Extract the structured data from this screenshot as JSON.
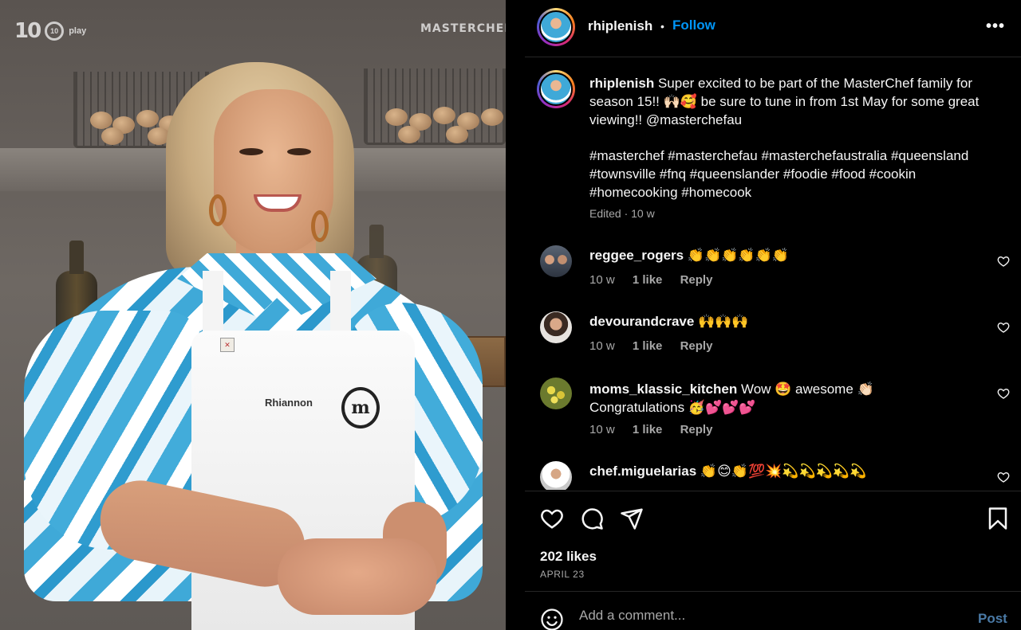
{
  "photo": {
    "network_logo": "10",
    "network_play": "play",
    "show_watermark": "MASTERCHEF",
    "apron_name": "Rhiannon",
    "apron_logo": "m"
  },
  "header": {
    "username": "rhiplenish",
    "separator": "•",
    "follow_label": "Follow",
    "more_icon": "more-options-icon",
    "more_glyph": "•••"
  },
  "caption": {
    "username": "rhiplenish",
    "text": "Super excited to be part of the MasterChef family for season 15!! 🙌🏻🥰 be sure to tune in from 1st May for some great viewing!! @masterchefau",
    "hashtags": "#masterchef #masterchefau #masterchefaustralia #queensland #townsville #fnq #queenslander #foodie #food #cookin #homecooking #homecook",
    "edited": "Edited · 10 w"
  },
  "comments": [
    {
      "username": "reggee_rogers",
      "text": "👏👏👏👏👏👏",
      "time": "10 w",
      "likes": "1 like",
      "reply": "Reply"
    },
    {
      "username": "devourandcrave",
      "text": "🙌🙌🙌",
      "time": "10 w",
      "likes": "1 like",
      "reply": "Reply"
    },
    {
      "username": "moms_klassic_kitchen",
      "text": "Wow 🤩 awesome 👏🏻 Congratulations 🥳💕💕💕",
      "time": "10 w",
      "likes": "1 like",
      "reply": "Reply"
    },
    {
      "username": "chef.miguelarias",
      "text": "👏😊👏💯💥💫💫💫💫💫",
      "time": "",
      "likes": "",
      "reply": ""
    }
  ],
  "actions": {
    "likes": "202 likes",
    "date": "APRIL 23"
  },
  "add_comment": {
    "placeholder": "Add a comment...",
    "post_label": "Post"
  },
  "colors": {
    "background": "#000000",
    "link_blue": "#0095f6",
    "secondary_text": "#a8a8a8",
    "divider": "#262626"
  }
}
